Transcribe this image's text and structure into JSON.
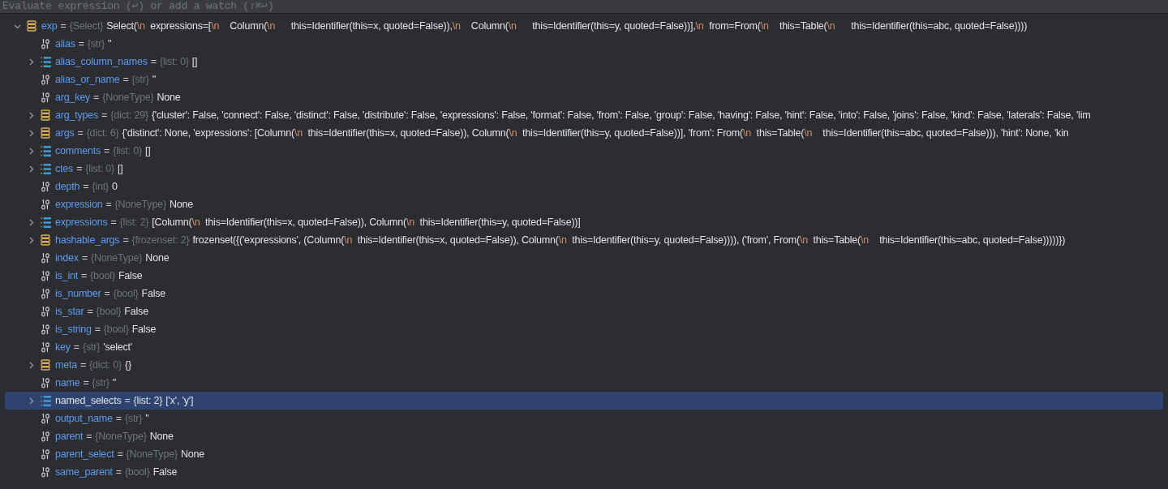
{
  "watch_field": {
    "placeholder": "Evaluate expression (↩) or add a watch (⇧⌘↩)"
  },
  "variables": [
    {
      "name": "exp",
      "kind": "object",
      "expanded": true,
      "selected": false,
      "sep": "=",
      "type": "{Select}",
      "value": "Select(\\n  expressions=[\\n    Column(\\n      this=Identifier(this=x, quoted=False)),\\n    Column(\\n      this=Identifier(this=y, quoted=False))],\\n  from=From(\\n    this=Table(\\n      this=Identifier(this=abc, quoted=False))))",
      "children": [
        {
          "name": "alias",
          "kind": "scalar",
          "selected": false,
          "sep": "=",
          "type": "{str}",
          "value": "''"
        },
        {
          "name": "alias_column_names",
          "kind": "list",
          "expanded": false,
          "selected": false,
          "sep": "=",
          "type": "{list: 0}",
          "value": "[]"
        },
        {
          "name": "alias_or_name",
          "kind": "scalar",
          "selected": false,
          "sep": "=",
          "type": "{str}",
          "value": "''"
        },
        {
          "name": "arg_key",
          "kind": "scalar",
          "selected": false,
          "sep": "=",
          "type": "{NoneType}",
          "value": "None"
        },
        {
          "name": "arg_types",
          "kind": "object",
          "expanded": false,
          "selected": false,
          "sep": "=",
          "type": "{dict: 29}",
          "value": "{'cluster': False, 'connect': False, 'distinct': False, 'distribute': False, 'expressions': False, 'format': False, 'from': False, 'group': False, 'having': False, 'hint': False, 'into': False, 'joins': False, 'kind': False, 'laterals': False, 'lim"
        },
        {
          "name": "args",
          "kind": "object",
          "expanded": false,
          "selected": false,
          "sep": "=",
          "type": "{dict: 6}",
          "value": "{'distinct': None, 'expressions': [Column(\\n  this=Identifier(this=x, quoted=False)), Column(\\n  this=Identifier(this=y, quoted=False))], 'from': From(\\n  this=Table(\\n    this=Identifier(this=abc, quoted=False))), 'hint': None, 'kin"
        },
        {
          "name": "comments",
          "kind": "list",
          "expanded": false,
          "selected": false,
          "sep": "=",
          "type": "{list: 0}",
          "value": "[]"
        },
        {
          "name": "ctes",
          "kind": "list",
          "expanded": false,
          "selected": false,
          "sep": "=",
          "type": "{list: 0}",
          "value": "[]"
        },
        {
          "name": "depth",
          "kind": "scalar",
          "selected": false,
          "sep": "=",
          "type": "{int}",
          "value": "0"
        },
        {
          "name": "expression",
          "kind": "scalar",
          "selected": false,
          "sep": "=",
          "type": "{NoneType}",
          "value": "None"
        },
        {
          "name": "expressions",
          "kind": "list",
          "expanded": false,
          "selected": false,
          "sep": "=",
          "type": "{list: 2}",
          "value": "[Column(\\n  this=Identifier(this=x, quoted=False)), Column(\\n  this=Identifier(this=y, quoted=False))]"
        },
        {
          "name": "hashable_args",
          "kind": "object",
          "expanded": false,
          "selected": false,
          "sep": "=",
          "type": "{frozenset: 2}",
          "value": "frozenset({('expressions', (Column(\\n  this=Identifier(this=x, quoted=False)), Column(\\n  this=Identifier(this=y, quoted=False)))), ('from', From(\\n  this=Table(\\n    this=Identifier(this=abc, quoted=False)))))})"
        },
        {
          "name": "index",
          "kind": "scalar",
          "selected": false,
          "sep": "=",
          "type": "{NoneType}",
          "value": "None"
        },
        {
          "name": "is_int",
          "kind": "scalar",
          "selected": false,
          "sep": "=",
          "type": "{bool}",
          "value": "False"
        },
        {
          "name": "is_number",
          "kind": "scalar",
          "selected": false,
          "sep": "=",
          "type": "{bool}",
          "value": "False"
        },
        {
          "name": "is_star",
          "kind": "scalar",
          "selected": false,
          "sep": "=",
          "type": "{bool}",
          "value": "False"
        },
        {
          "name": "is_string",
          "kind": "scalar",
          "selected": false,
          "sep": "=",
          "type": "{bool}",
          "value": "False"
        },
        {
          "name": "key",
          "kind": "scalar",
          "selected": false,
          "sep": "=",
          "type": "{str}",
          "value": "'select'"
        },
        {
          "name": "meta",
          "kind": "object",
          "expanded": false,
          "selected": false,
          "sep": "=",
          "type": "{dict: 0}",
          "value": "{}"
        },
        {
          "name": "name",
          "kind": "scalar",
          "selected": false,
          "sep": "=",
          "type": "{str}",
          "value": "''"
        },
        {
          "name": "named_selects",
          "kind": "list",
          "expanded": false,
          "selected": true,
          "sep": "=",
          "type": "{list: 2}",
          "value": "['x', 'y']"
        },
        {
          "name": "output_name",
          "kind": "scalar",
          "selected": false,
          "sep": "=",
          "type": "{str}",
          "value": "''"
        },
        {
          "name": "parent",
          "kind": "scalar",
          "selected": false,
          "sep": "=",
          "type": "{NoneType}",
          "value": "None"
        },
        {
          "name": "parent_select",
          "kind": "scalar",
          "selected": false,
          "sep": "=",
          "type": "{NoneType}",
          "value": "None"
        },
        {
          "name": "same_parent",
          "kind": "scalar",
          "selected": false,
          "sep": "=",
          "type": "{bool}",
          "value": "False"
        }
      ]
    }
  ]
}
